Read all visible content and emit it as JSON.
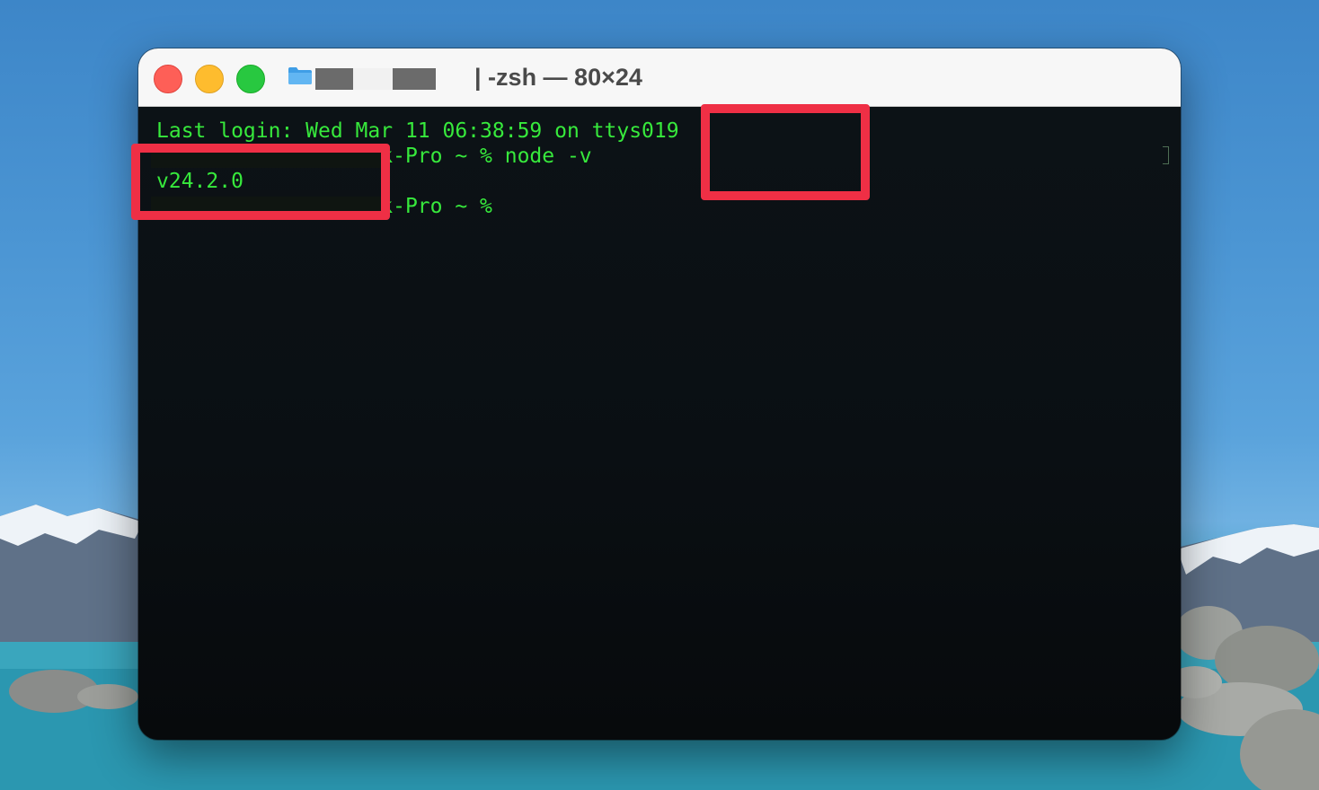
{
  "window": {
    "title": "| -zsh — 80×24",
    "traffic_lights": [
      "close",
      "minimize",
      "zoom"
    ],
    "folder_icon": "folder-icon"
  },
  "terminal": {
    "lines": [
      "Last login: Wed Mar 11 06:38:59 on ttys019",
      "noufutoshinoMacBook-Pro ~ % node -v",
      "v24.2.0",
      "noufutoshinoMacBook-Pro ~ %"
    ],
    "text_color": "#37e93c",
    "background_color": "#0b0f13"
  },
  "annotations": {
    "color": "#ef2f45",
    "highlighted": [
      "node -v",
      "v24.2.0"
    ]
  },
  "colors": {
    "titlebar": "#f7f7f7",
    "close": "#fe5f57",
    "minimize": "#febc2e",
    "zoom": "#28c840"
  }
}
